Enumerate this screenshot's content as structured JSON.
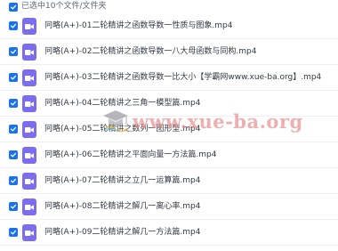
{
  "header": {
    "selection_label": "已选中10个文件/文件夹",
    "select_all_checked": true
  },
  "files": [
    {
      "name": "冋略(A+)-01二轮精讲之函数导数一性质与图象.mp4",
      "checked": true
    },
    {
      "name": "冋略(A+)-02二轮精讲之函数导数一八大母函数与同构.mp4",
      "checked": true
    },
    {
      "name": "冋略(A+)-03二轮精讲之函数导数一比大小【学霸网www.xue-ba.org】.mp4",
      "checked": true
    },
    {
      "name": "冋略(A+)-04二轮精讲之三角一模型篇.mp4",
      "checked": true
    },
    {
      "name": "冋略(A+)-05二轮精讲之数列一图形型.mp4",
      "checked": true
    },
    {
      "name": "冋略(A+)-06二轮精讲之平面向量一方法篇.mp4",
      "checked": true
    },
    {
      "name": "冋略(A+)-07二轮精讲之立几一运算篇.mp4",
      "checked": true
    },
    {
      "name": "冋略(A+)-08二轮精讲之解几一离心率.mp4",
      "checked": true
    },
    {
      "name": "冋略(A+)-09二轮精讲之解几一方法篇.mp4",
      "checked": true
    }
  ],
  "watermark": {
    "text": "www.xue-ba.org"
  },
  "colors": {
    "checkbox": "#1a73e8",
    "video_icon": "#7b6cf0",
    "watermark": "#e58a8a"
  },
  "icons": {
    "checkbox": "check-icon",
    "file": "video-file-icon",
    "watermark": "graduation-cap-logo"
  }
}
